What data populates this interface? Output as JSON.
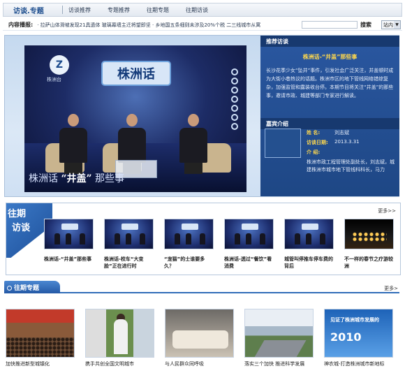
{
  "topnav": {
    "brand": "访谈.专题",
    "links": [
      "访谈推荐",
      "专题推荐",
      "往期专题",
      "往期访谈"
    ]
  },
  "ticker": {
    "label": "内容播报:",
    "text": "· 拉萨山体滑坡发现21具遗体   玻璃幕墙主迁将望即坚   · 乡地国五条细则未涉及20%个税   二三线城市从寓",
    "search_placeholder": "",
    "search_label": "搜索",
    "site_select": "站内"
  },
  "hero": {
    "video": {
      "tv_name": "株洲台",
      "banner_text": "株洲话",
      "caption_prefix": "株洲话",
      "caption_quote": "“井盖”",
      "caption_suffix": "那些事"
    },
    "recommend": {
      "heading": "推荐访谈",
      "title": "株洲话-“井盖”那些事",
      "description": "长沙花季少女“坠井”事件，引发社会广泛关注，并盖顿时成为大街小巷热议的话题。株洲市区的地下管线网络错综复杂，加强监管和露装收台停。本期节目将关注“井盖”的那些事，邀请市政、城建等部门专家进行解读。"
    },
    "guest": {
      "heading": "嘉宾介绍",
      "name_label": "姓 名:",
      "name": "刘志斌",
      "date_label": "访谈日期:",
      "date": "2013.3.31",
      "intro_label": "介 绍:",
      "intro": "株洲市政工程管理处副处长，刘志斌，城建株洲市城市地下管线科科长，马力"
    }
  },
  "past_interviews": {
    "banner_line1": "往期",
    "banner_line2": "访谈",
    "more": "更多>>",
    "items": [
      {
        "caption": "株洲话-“井盖”那些事"
      },
      {
        "caption": "株洲话-校车“大变脸”正在进行时"
      },
      {
        "caption": "“宠猫”的士谁要多久？"
      },
      {
        "caption": "株洲话-透过“餐饮”看消费"
      },
      {
        "caption": "城管叫停推车停车费的背后"
      },
      {
        "caption": "不一样的春节之疗游较洲"
      }
    ]
  },
  "past_topics": {
    "heading": "往期专题",
    "more": "更多>",
    "items": [
      {
        "caption": "加快推进新型城镇化"
      },
      {
        "caption": "携手共创全国文明城市"
      },
      {
        "caption": "与人民群众同呼吸"
      },
      {
        "caption": "落实三个加快  推进科学发展"
      },
      {
        "caption": "神农城-打造株洲城市新地标"
      }
    ],
    "banner_year": "2010",
    "banner_title": "见证了株洲城市发展的"
  }
}
